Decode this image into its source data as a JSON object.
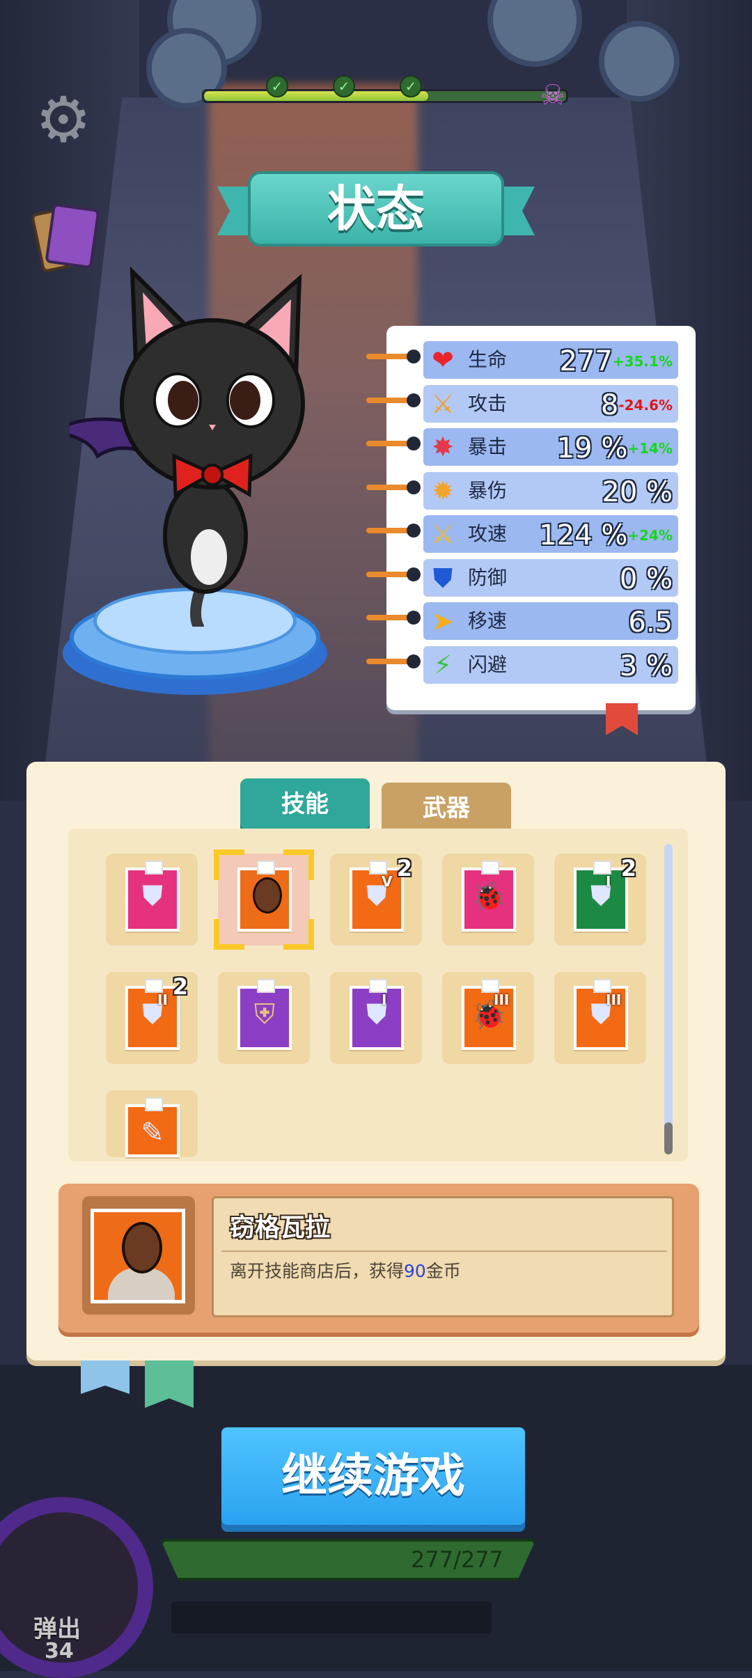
{
  "header": {
    "title": "状态"
  },
  "hud": {
    "gear_icon": "gear-icon",
    "cards_icon": "cards-icon",
    "wave_progress": 0.62
  },
  "stats": [
    {
      "name": "生命",
      "value": "277",
      "delta": "+35.1%",
      "delta_dir": "up",
      "icon": "heart-icon",
      "glyph": "❤",
      "color": "#e8252b"
    },
    {
      "name": "攻击",
      "value": "8",
      "delta": "-24.6%",
      "delta_dir": "down",
      "icon": "sword-icon",
      "glyph": "⚔",
      "color": "#f0a02b"
    },
    {
      "name": "暴击",
      "value": "19 %",
      "delta": "+14%",
      "delta_dir": "up",
      "icon": "crit-icon",
      "glyph": "✸",
      "color": "#e23a4c"
    },
    {
      "name": "暴伤",
      "value": "20 %",
      "delta": "",
      "delta_dir": "",
      "icon": "crit-damage-icon",
      "glyph": "✹",
      "color": "#f2a42a"
    },
    {
      "name": "攻速",
      "value": "124 %",
      "delta": "+24%",
      "delta_dir": "up",
      "icon": "attack-speed-icon",
      "glyph": "⚔",
      "color": "#f0b73a"
    },
    {
      "name": "防御",
      "value": "0 %",
      "delta": "",
      "delta_dir": "",
      "icon": "shield-icon",
      "glyph": "⛊",
      "color": "#1f59d6"
    },
    {
      "name": "移速",
      "value": "6.5",
      "delta": "",
      "delta_dir": "",
      "icon": "move-speed-icon",
      "glyph": "➤",
      "color": "#f2b01e"
    },
    {
      "name": "闪避",
      "value": "3 %",
      "delta": "",
      "delta_dir": "",
      "icon": "dodge-icon",
      "glyph": "⚡",
      "color": "#3ec04a"
    }
  ],
  "tabs": {
    "skills": "技能",
    "weapons": "武器"
  },
  "skills": [
    {
      "kind": "shield",
      "color": "pink",
      "tier": "",
      "level": ""
    },
    {
      "kind": "person",
      "color": "person",
      "tier": "",
      "level": "",
      "selected": true
    },
    {
      "kind": "shield",
      "color": "orange",
      "tier": "V",
      "level": "2"
    },
    {
      "kind": "bug",
      "color": "pink",
      "tier": "",
      "level": ""
    },
    {
      "kind": "shield",
      "color": "green",
      "tier": "I",
      "level": "2"
    },
    {
      "kind": "shield",
      "color": "orange",
      "tier": "II",
      "level": "2"
    },
    {
      "kind": "shields",
      "color": "purple",
      "tier": "",
      "level": ""
    },
    {
      "kind": "shield",
      "color": "purple",
      "tier": "I",
      "level": ""
    },
    {
      "kind": "bug",
      "color": "orange",
      "tier": "III",
      "level": ""
    },
    {
      "kind": "shield",
      "color": "orange",
      "tier": "III",
      "level": ""
    },
    {
      "kind": "partial",
      "color": "orange",
      "tier": "",
      "level": ""
    }
  ],
  "selected_skill": {
    "name": "窃格瓦拉",
    "desc_before": "离开技能商店后，获得",
    "desc_number": "90",
    "desc_after": "金币"
  },
  "buttons": {
    "continue": "继续游戏"
  },
  "player": {
    "hp_text": "277/277",
    "eject_label": "弹出",
    "eject_count": "34"
  }
}
